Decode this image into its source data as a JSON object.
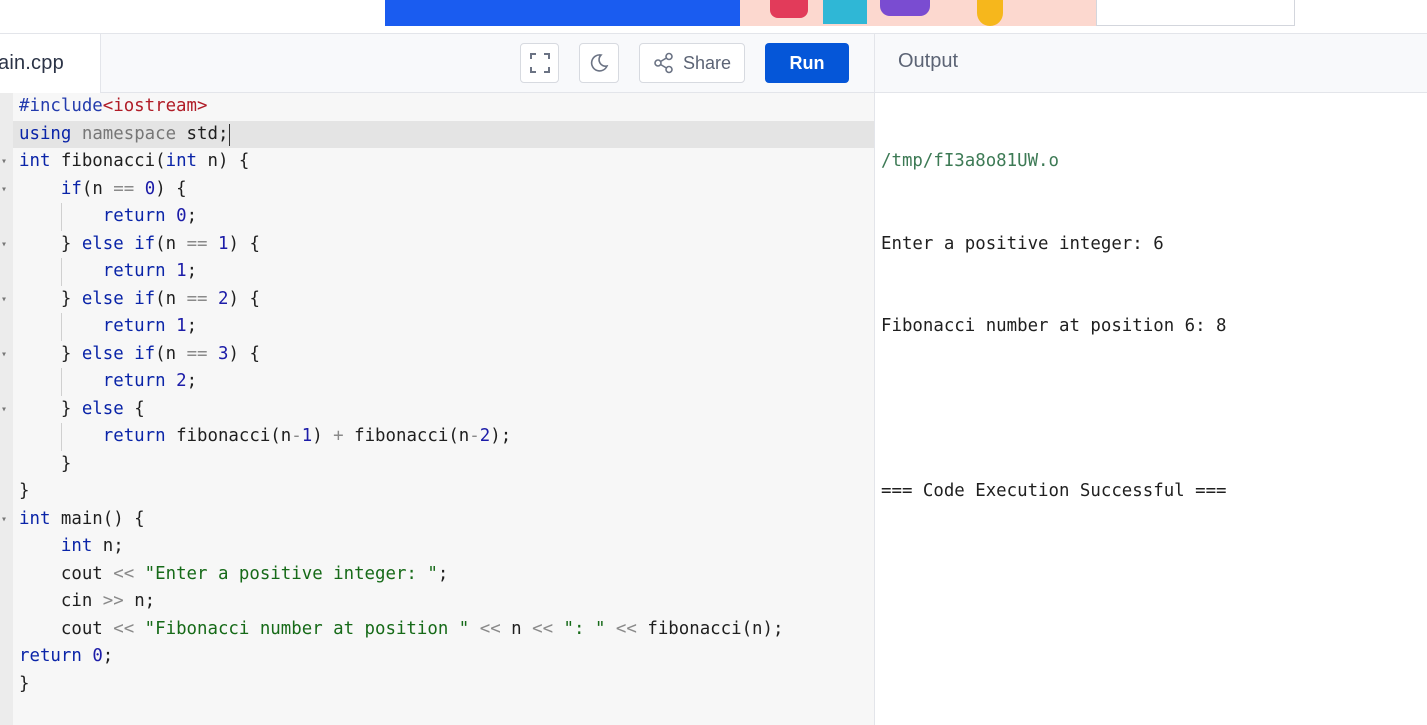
{
  "topbar": {
    "colors": {
      "banner": "#1a5cf0"
    }
  },
  "editor": {
    "filename": "ain.cpp",
    "toolbar": {
      "fullscreen_icon": "fullscreen-icon",
      "theme_icon": "moon-icon",
      "share_icon": "share-icon",
      "share_label": "Share",
      "run_label": "Run"
    },
    "lines": [
      {
        "fold": false,
        "tokens": [
          [
            "pp",
            "#include"
          ],
          [
            "hdr",
            "<iostream>"
          ]
        ]
      },
      {
        "fold": false,
        "tokens": [
          [
            "kw",
            "using"
          ],
          [
            "t",
            " "
          ],
          [
            "ns",
            "namespace"
          ],
          [
            "t",
            " std;"
          ]
        ]
      },
      {
        "fold": true,
        "tokens": [
          [
            "kw",
            "int"
          ],
          [
            "t",
            " fibonacci("
          ],
          [
            "kw",
            "int"
          ],
          [
            "t",
            " n) {"
          ]
        ]
      },
      {
        "fold": true,
        "tokens": [
          [
            "t",
            "    "
          ],
          [
            "kw",
            "if"
          ],
          [
            "t",
            "(n "
          ],
          [
            "op",
            "=="
          ],
          [
            "t",
            " "
          ],
          [
            "num",
            "0"
          ],
          [
            "t",
            ") {"
          ]
        ]
      },
      {
        "fold": false,
        "tokens": [
          [
            "t",
            "        "
          ],
          [
            "kw",
            "return"
          ],
          [
            "t",
            " "
          ],
          [
            "num",
            "0"
          ],
          [
            "t",
            ";"
          ]
        ]
      },
      {
        "fold": true,
        "tokens": [
          [
            "t",
            "    } "
          ],
          [
            "kw",
            "else"
          ],
          [
            "t",
            " "
          ],
          [
            "kw",
            "if"
          ],
          [
            "t",
            "(n "
          ],
          [
            "op",
            "=="
          ],
          [
            "t",
            " "
          ],
          [
            "num",
            "1"
          ],
          [
            "t",
            ") {"
          ]
        ]
      },
      {
        "fold": false,
        "tokens": [
          [
            "t",
            "        "
          ],
          [
            "kw",
            "return"
          ],
          [
            "t",
            " "
          ],
          [
            "num",
            "1"
          ],
          [
            "t",
            ";"
          ]
        ]
      },
      {
        "fold": true,
        "tokens": [
          [
            "t",
            "    } "
          ],
          [
            "kw",
            "else"
          ],
          [
            "t",
            " "
          ],
          [
            "kw",
            "if"
          ],
          [
            "t",
            "(n "
          ],
          [
            "op",
            "=="
          ],
          [
            "t",
            " "
          ],
          [
            "num",
            "2"
          ],
          [
            "t",
            ") {"
          ]
        ]
      },
      {
        "fold": false,
        "tokens": [
          [
            "t",
            "        "
          ],
          [
            "kw",
            "return"
          ],
          [
            "t",
            " "
          ],
          [
            "num",
            "1"
          ],
          [
            "t",
            ";"
          ]
        ]
      },
      {
        "fold": true,
        "tokens": [
          [
            "t",
            "    } "
          ],
          [
            "kw",
            "else"
          ],
          [
            "t",
            " "
          ],
          [
            "kw",
            "if"
          ],
          [
            "t",
            "(n "
          ],
          [
            "op",
            "=="
          ],
          [
            "t",
            " "
          ],
          [
            "num",
            "3"
          ],
          [
            "t",
            ") {"
          ]
        ]
      },
      {
        "fold": false,
        "tokens": [
          [
            "t",
            "        "
          ],
          [
            "kw",
            "return"
          ],
          [
            "t",
            " "
          ],
          [
            "num",
            "2"
          ],
          [
            "t",
            ";"
          ]
        ]
      },
      {
        "fold": true,
        "tokens": [
          [
            "t",
            "    } "
          ],
          [
            "kw",
            "else"
          ],
          [
            "t",
            " {"
          ]
        ]
      },
      {
        "fold": false,
        "tokens": [
          [
            "t",
            "        "
          ],
          [
            "kw",
            "return"
          ],
          [
            "t",
            " fibonacci(n"
          ],
          [
            "op",
            "-"
          ],
          [
            "num",
            "1"
          ],
          [
            "t",
            ") "
          ],
          [
            "op",
            "+"
          ],
          [
            "t",
            " fibonacci(n"
          ],
          [
            "op",
            "-"
          ],
          [
            "num",
            "2"
          ],
          [
            "t",
            ");"
          ]
        ]
      },
      {
        "fold": false,
        "tokens": [
          [
            "t",
            "    }"
          ]
        ]
      },
      {
        "fold": false,
        "tokens": [
          [
            "t",
            "}"
          ]
        ]
      },
      {
        "fold": true,
        "tokens": [
          [
            "kw",
            "int"
          ],
          [
            "t",
            " main() {"
          ]
        ]
      },
      {
        "fold": false,
        "tokens": [
          [
            "t",
            "    "
          ],
          [
            "kw",
            "int"
          ],
          [
            "t",
            " n;"
          ]
        ]
      },
      {
        "fold": false,
        "tokens": [
          [
            "t",
            "    cout "
          ],
          [
            "op",
            "<<"
          ],
          [
            "t",
            " "
          ],
          [
            "str",
            "\"Enter a positive integer: \""
          ],
          [
            "t",
            ";"
          ]
        ]
      },
      {
        "fold": false,
        "tokens": [
          [
            "t",
            "    cin "
          ],
          [
            "op",
            ">>"
          ],
          [
            "t",
            " n;"
          ]
        ]
      },
      {
        "fold": false,
        "tokens": [
          [
            "t",
            "    cout "
          ],
          [
            "op",
            "<<"
          ],
          [
            "t",
            " "
          ],
          [
            "str",
            "\"Fibonacci number at position \""
          ],
          [
            "t",
            " "
          ],
          [
            "op",
            "<<"
          ],
          [
            "t",
            " n "
          ],
          [
            "op",
            "<<"
          ],
          [
            "t",
            " "
          ],
          [
            "str",
            "\": \""
          ],
          [
            "t",
            " "
          ],
          [
            "op",
            "<<"
          ],
          [
            "t",
            " fibonacci(n);"
          ]
        ]
      },
      {
        "fold": false,
        "tokens": [
          [
            "kw",
            "return"
          ],
          [
            "t",
            " "
          ],
          [
            "num",
            "0"
          ],
          [
            "t",
            ";"
          ]
        ]
      },
      {
        "fold": false,
        "tokens": [
          [
            "t",
            "}"
          ]
        ]
      }
    ]
  },
  "output": {
    "header": "Output",
    "path": "/tmp/fI3a8o81UW.o",
    "lines": [
      "Enter a positive integer: 6",
      "Fibonacci number at position 6: 8",
      "",
      "=== Code Execution Successful ==="
    ]
  }
}
